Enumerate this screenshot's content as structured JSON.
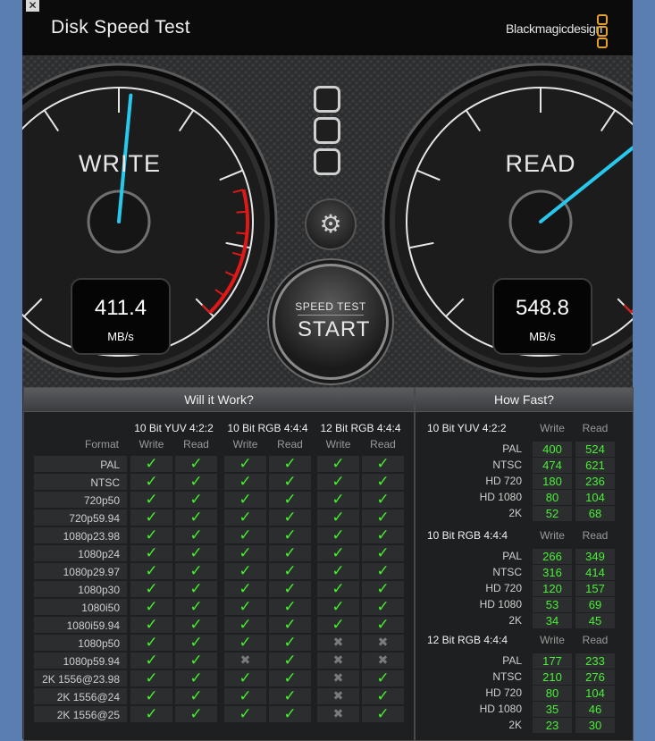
{
  "window": {
    "title": "Disk Speed Test",
    "brand": "Blackmagicdesign"
  },
  "write_gauge": {
    "label": "WRITE",
    "value": "411.4",
    "unit": "MB/s",
    "needle_fraction": 0.52
  },
  "read_gauge": {
    "label": "READ",
    "value": "548.8",
    "unit": "MB/s",
    "needle_fraction": 0.69
  },
  "start_button": {
    "small": "SPEED TEST",
    "big": "START"
  },
  "will_it_work": {
    "title": "Will it Work?",
    "format_header": "Format",
    "groups": [
      {
        "name": "10 Bit YUV 4:2:2",
        "write": "Write",
        "read": "Read"
      },
      {
        "name": "10 Bit RGB 4:4:4",
        "write": "Write",
        "read": "Read"
      },
      {
        "name": "12 Bit RGB 4:4:4",
        "write": "Write",
        "read": "Read"
      }
    ],
    "rows": [
      {
        "format": "PAL",
        "marks": [
          "y",
          "y",
          "y",
          "y",
          "y",
          "y"
        ]
      },
      {
        "format": "NTSC",
        "marks": [
          "y",
          "y",
          "y",
          "y",
          "y",
          "y"
        ]
      },
      {
        "format": "720p50",
        "marks": [
          "y",
          "y",
          "y",
          "y",
          "y",
          "y"
        ]
      },
      {
        "format": "720p59.94",
        "marks": [
          "y",
          "y",
          "y",
          "y",
          "y",
          "y"
        ]
      },
      {
        "format": "1080p23.98",
        "marks": [
          "y",
          "y",
          "y",
          "y",
          "y",
          "y"
        ]
      },
      {
        "format": "1080p24",
        "marks": [
          "y",
          "y",
          "y",
          "y",
          "y",
          "y"
        ]
      },
      {
        "format": "1080p29.97",
        "marks": [
          "y",
          "y",
          "y",
          "y",
          "y",
          "y"
        ]
      },
      {
        "format": "1080p30",
        "marks": [
          "y",
          "y",
          "y",
          "y",
          "y",
          "y"
        ]
      },
      {
        "format": "1080i50",
        "marks": [
          "y",
          "y",
          "y",
          "y",
          "y",
          "y"
        ]
      },
      {
        "format": "1080i59.94",
        "marks": [
          "y",
          "y",
          "y",
          "y",
          "y",
          "y"
        ]
      },
      {
        "format": "1080p50",
        "marks": [
          "y",
          "y",
          "y",
          "y",
          "n",
          "n"
        ]
      },
      {
        "format": "1080p59.94",
        "marks": [
          "y",
          "y",
          "n",
          "y",
          "n",
          "n"
        ]
      },
      {
        "format": "2K 1556@23.98",
        "marks": [
          "y",
          "y",
          "y",
          "y",
          "n",
          "y"
        ]
      },
      {
        "format": "2K 1556@24",
        "marks": [
          "y",
          "y",
          "y",
          "y",
          "n",
          "y"
        ]
      },
      {
        "format": "2K 1556@25",
        "marks": [
          "y",
          "y",
          "y",
          "y",
          "n",
          "y"
        ]
      }
    ]
  },
  "how_fast": {
    "title": "How Fast?",
    "sections": [
      {
        "name": "10 Bit YUV 4:2:2",
        "write": "Write",
        "read": "Read",
        "rows": [
          {
            "fmt": "PAL",
            "w": "400",
            "r": "524"
          },
          {
            "fmt": "NTSC",
            "w": "474",
            "r": "621"
          },
          {
            "fmt": "HD 720",
            "w": "180",
            "r": "236"
          },
          {
            "fmt": "HD 1080",
            "w": "80",
            "r": "104"
          },
          {
            "fmt": "2K",
            "w": "52",
            "r": "68"
          }
        ]
      },
      {
        "name": "10 Bit RGB 4:4:4",
        "write": "Write",
        "read": "Read",
        "rows": [
          {
            "fmt": "PAL",
            "w": "266",
            "r": "349"
          },
          {
            "fmt": "NTSC",
            "w": "316",
            "r": "414"
          },
          {
            "fmt": "HD 720",
            "w": "120",
            "r": "157"
          },
          {
            "fmt": "HD 1080",
            "w": "53",
            "r": "69"
          },
          {
            "fmt": "2K",
            "w": "34",
            "r": "45"
          }
        ]
      },
      {
        "name": "12 Bit RGB 4:4:4",
        "write": "Write",
        "read": "Read",
        "rows": [
          {
            "fmt": "PAL",
            "w": "177",
            "r": "233"
          },
          {
            "fmt": "NTSC",
            "w": "210",
            "r": "276"
          },
          {
            "fmt": "HD 720",
            "w": "80",
            "r": "104"
          },
          {
            "fmt": "HD 1080",
            "w": "35",
            "r": "46"
          },
          {
            "fmt": "2K",
            "w": "23",
            "r": "30"
          }
        ]
      }
    ]
  },
  "colors": {
    "accent": "#43f02c",
    "needle": "#27c8ec",
    "redzone": "#e01818",
    "brand_logo": "#e3a12c"
  }
}
